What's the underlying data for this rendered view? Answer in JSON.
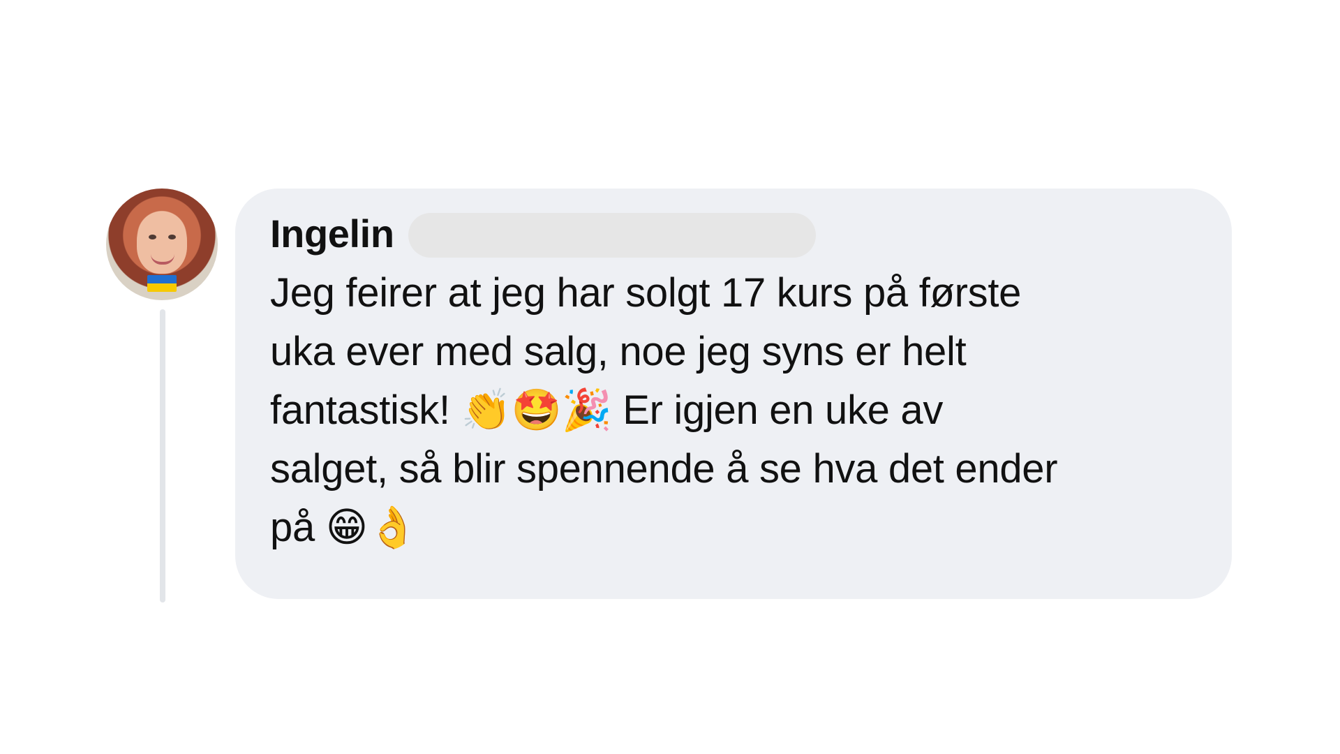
{
  "comment": {
    "author_name": "Ingelin",
    "text": "Jeg feirer at jeg har solgt 17 kurs på første\nuka ever med salg, noe jeg syns er helt\nfantastisk! 👏🤩🎉 Er igjen en uke av\nsalget, så blir spennende å se hva det ender\npå 😁👌"
  },
  "avatar": {
    "icon": "profile-photo-with-ukraine-flag"
  },
  "colors": {
    "bubble": "#eef0f4",
    "thread_line": "#e2e5e9",
    "text": "#111111"
  }
}
